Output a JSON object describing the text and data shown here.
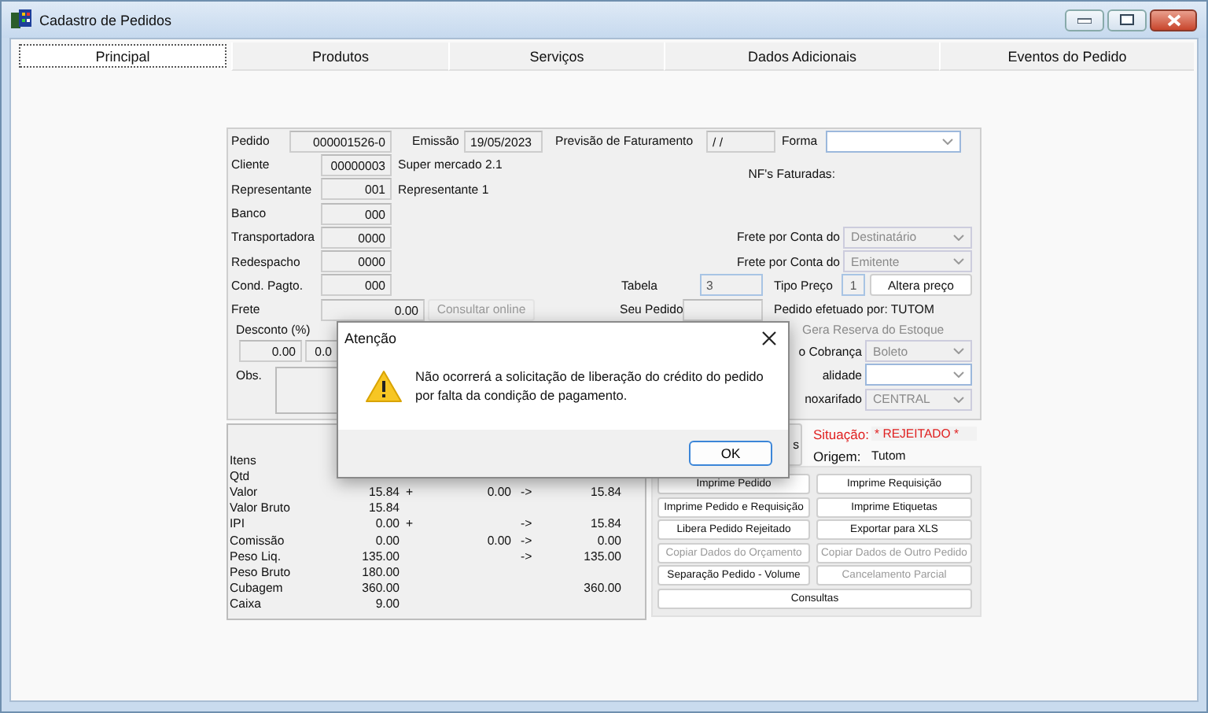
{
  "window": {
    "title": "Cadastro de Pedidos"
  },
  "tabs": [
    {
      "label": "Principal",
      "selected": true
    },
    {
      "label": "Produtos",
      "selected": false
    },
    {
      "label": "Serviços",
      "selected": false
    },
    {
      "label": "Dados Adicionais",
      "selected": false
    },
    {
      "label": "Eventos do Pedido",
      "selected": false
    }
  ],
  "header": {
    "pedido": {
      "label": "Pedido",
      "value": "000001526-0"
    },
    "emissao": {
      "label": "Emissão",
      "value": "19/05/2023"
    },
    "previsao": {
      "label": "Previsão de Faturamento",
      "value": "/ /"
    },
    "forma": {
      "label": "Forma",
      "disabled": false
    }
  },
  "fields": [
    {
      "label": "Cliente",
      "value": "00000003",
      "description": "Super mercado 2.1"
    },
    {
      "label": "Representante",
      "value": "001",
      "description": "Representante 1"
    },
    {
      "label": "Banco",
      "value": "000"
    },
    {
      "label": "Transportadora",
      "value": "0000"
    },
    {
      "label": "Redespacho",
      "value": "0000"
    },
    {
      "label": "Cond. Pagto.",
      "value": "000"
    }
  ],
  "nfs_label": "NF's Faturadas:",
  "frete_conta": [
    {
      "label": "Frete por Conta do",
      "value": "Destinatário",
      "disabled": true
    },
    {
      "label": "Frete por Conta do",
      "value": "Emitente",
      "disabled": true
    }
  ],
  "tabela": {
    "label": "Tabela",
    "value": "3"
  },
  "tipo_preco": {
    "label": "Tipo Preço",
    "value": "1"
  },
  "altera_preco": {
    "label": "Altera preço",
    "disabled": false
  },
  "frete": {
    "label": "Frete",
    "value": "0.00"
  },
  "consultar_online": {
    "label": "Consultar online",
    "disabled": true
  },
  "seu_pedido": {
    "label": "Seu Pedido"
  },
  "efetuado_por": "Pedido efetuado por: TUTOM",
  "gera_reserva": {
    "label": "Gera Reserva do Estoque",
    "disabled": true
  },
  "desconto": {
    "label": "Desconto (%)",
    "values": [
      "0.00",
      "0.0"
    ]
  },
  "obs": {
    "label": "Obs."
  },
  "side_combos": [
    {
      "label": "o Cobrança",
      "value": "Boleto",
      "disabled": true
    },
    {
      "label": "alidade",
      "disabled": false
    },
    {
      "label": "noxarifado",
      "value": "CENTRAL",
      "disabled": true
    }
  ],
  "totals": {
    "items_label": "Itens",
    "rows": [
      {
        "label": "Qtd"
      },
      {
        "label": "Valor",
        "value": "15.84",
        "op": "+",
        "extra": "0.00",
        "arrow": "->",
        "total": "15.84"
      },
      {
        "label": "Valor Bruto",
        "value": "15.84"
      },
      {
        "label": "IPI",
        "value": "0.00",
        "op": "+",
        "arrow": "->",
        "total": "15.84"
      },
      {
        "label": "Comissão",
        "value": "0.00",
        "extra": "0.00",
        "arrow": "->",
        "total": "0.00"
      },
      {
        "label": "Peso Liq.",
        "value": "135.00",
        "arrow": "->",
        "total": "135.00"
      },
      {
        "label": "Peso Bruto",
        "value": "180.00"
      },
      {
        "label": "Cubagem",
        "value": "360.00",
        "total": "360.00"
      },
      {
        "label": "Caixa",
        "value": "9.00"
      }
    ]
  },
  "partial_button": "s",
  "status": {
    "situacao_label": "Situação:",
    "situacao": "* REJEITADO *",
    "origem_label": "Origem:",
    "origem": "Tutom"
  },
  "actions": [
    {
      "label": "Imprime Pedido",
      "disabled": false
    },
    {
      "label": "Imprime Requisição",
      "disabled": false
    },
    {
      "label": "Imprime Pedido e Requisição",
      "disabled": false
    },
    {
      "label": "Imprime Etiquetas",
      "disabled": false
    },
    {
      "label": "Libera Pedido Rejeitado",
      "disabled": false
    },
    {
      "label": "Exportar para XLS",
      "disabled": false
    },
    {
      "label": "Copiar Dados do Orçamento",
      "disabled": true
    },
    {
      "label": "Copiar Dados de Outro Pedido",
      "disabled": true
    },
    {
      "label": "Separação Pedido - Volume",
      "disabled": false
    },
    {
      "label": "Cancelamento Parcial",
      "disabled": true
    },
    {
      "label": "Consultas",
      "disabled": false
    }
  ],
  "dialog": {
    "title": "Atenção",
    "message": "Não ocorrerá a solicitação de liberação do crédito do pedido\npor falta da condição de pagamento.",
    "button": "OK"
  }
}
